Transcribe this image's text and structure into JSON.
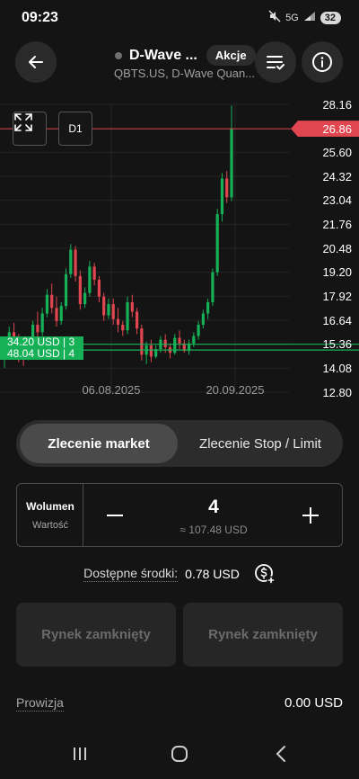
{
  "status_bar": {
    "time": "09:23",
    "network": "5G",
    "battery": "32"
  },
  "header": {
    "title": "D-Wave ...",
    "badge": "Akcje",
    "subtitle": "QBTS.US, D-Wave Quan..."
  },
  "chart": {
    "timeframe": "D1",
    "current_price": "26.86",
    "orders": [
      {
        "label": "34.20 USD | 3"
      },
      {
        "label": "48.04 USD | 4"
      }
    ],
    "colors": {
      "up": "#16b157",
      "down": "#e0464f",
      "price_line": "#e0464f",
      "order_line": "#16b157"
    }
  },
  "chart_data": {
    "type": "candlestick",
    "x_tick_labels": [
      "06.08.2025",
      "20.09.2025"
    ],
    "y_tick_labels": [
      "28.16",
      "26.86",
      "25.60",
      "24.32",
      "23.04",
      "21.76",
      "20.48",
      "19.20",
      "17.92",
      "16.64",
      "15.36",
      "14.08",
      "12.80"
    ],
    "ylim": [
      12.8,
      28.16
    ],
    "last_price": 26.86,
    "order_lines": [
      15.36,
      15.05
    ],
    "candles": [
      {
        "o": 14.7,
        "h": 15.6,
        "l": 14.1,
        "c": 15.2
      },
      {
        "o": 15.2,
        "h": 16.3,
        "l": 15.0,
        "c": 16.0
      },
      {
        "o": 16.0,
        "h": 16.5,
        "l": 14.9,
        "c": 15.1
      },
      {
        "o": 15.1,
        "h": 15.9,
        "l": 14.4,
        "c": 14.8
      },
      {
        "o": 14.8,
        "h": 15.3,
        "l": 14.2,
        "c": 14.6
      },
      {
        "o": 14.6,
        "h": 15.7,
        "l": 14.5,
        "c": 15.5
      },
      {
        "o": 15.5,
        "h": 16.6,
        "l": 15.3,
        "c": 16.4
      },
      {
        "o": 16.4,
        "h": 17.1,
        "l": 15.7,
        "c": 16.0
      },
      {
        "o": 16.0,
        "h": 17.3,
        "l": 15.8,
        "c": 17.0
      },
      {
        "o": 17.0,
        "h": 18.3,
        "l": 16.8,
        "c": 18.0
      },
      {
        "o": 18.0,
        "h": 18.6,
        "l": 17.0,
        "c": 17.3
      },
      {
        "o": 17.3,
        "h": 17.9,
        "l": 16.3,
        "c": 16.6
      },
      {
        "o": 16.6,
        "h": 17.6,
        "l": 16.4,
        "c": 17.4
      },
      {
        "o": 17.4,
        "h": 19.4,
        "l": 17.2,
        "c": 19.1
      },
      {
        "o": 19.1,
        "h": 20.7,
        "l": 18.9,
        "c": 20.4
      },
      {
        "o": 20.4,
        "h": 20.6,
        "l": 18.7,
        "c": 19.0
      },
      {
        "o": 19.0,
        "h": 19.3,
        "l": 17.2,
        "c": 17.5
      },
      {
        "o": 17.5,
        "h": 18.4,
        "l": 17.3,
        "c": 18.1
      },
      {
        "o": 18.1,
        "h": 19.8,
        "l": 17.9,
        "c": 19.5
      },
      {
        "o": 19.5,
        "h": 19.7,
        "l": 18.5,
        "c": 18.8
      },
      {
        "o": 18.8,
        "h": 19.0,
        "l": 17.6,
        "c": 17.9
      },
      {
        "o": 17.9,
        "h": 18.1,
        "l": 16.6,
        "c": 16.9
      },
      {
        "o": 16.9,
        "h": 17.8,
        "l": 16.7,
        "c": 17.5
      },
      {
        "o": 17.5,
        "h": 17.8,
        "l": 16.4,
        "c": 16.7
      },
      {
        "o": 16.7,
        "h": 17.3,
        "l": 16.0,
        "c": 16.4
      },
      {
        "o": 16.4,
        "h": 16.6,
        "l": 15.8,
        "c": 16.1
      },
      {
        "o": 16.1,
        "h": 17.9,
        "l": 15.9,
        "c": 17.6
      },
      {
        "o": 17.6,
        "h": 18.0,
        "l": 16.8,
        "c": 17.1
      },
      {
        "o": 17.1,
        "h": 17.3,
        "l": 15.9,
        "c": 16.2
      },
      {
        "o": 16.2,
        "h": 16.4,
        "l": 14.5,
        "c": 14.8
      },
      {
        "o": 14.8,
        "h": 15.5,
        "l": 14.3,
        "c": 15.3
      },
      {
        "o": 15.3,
        "h": 15.6,
        "l": 14.4,
        "c": 14.7
      },
      {
        "o": 14.7,
        "h": 15.3,
        "l": 14.6,
        "c": 15.1
      },
      {
        "o": 15.1,
        "h": 15.8,
        "l": 14.9,
        "c": 15.6
      },
      {
        "o": 15.6,
        "h": 15.9,
        "l": 14.9,
        "c": 15.2
      },
      {
        "o": 15.2,
        "h": 15.4,
        "l": 14.6,
        "c": 14.9
      },
      {
        "o": 14.9,
        "h": 15.9,
        "l": 14.8,
        "c": 15.7
      },
      {
        "o": 15.7,
        "h": 16.1,
        "l": 15.1,
        "c": 15.4
      },
      {
        "o": 15.4,
        "h": 15.6,
        "l": 14.9,
        "c": 15.0
      },
      {
        "o": 15.0,
        "h": 15.6,
        "l": 14.8,
        "c": 15.4
      },
      {
        "o": 15.4,
        "h": 16.0,
        "l": 15.2,
        "c": 15.8
      },
      {
        "o": 15.8,
        "h": 16.6,
        "l": 15.6,
        "c": 16.4
      },
      {
        "o": 16.4,
        "h": 17.2,
        "l": 16.2,
        "c": 17.0
      },
      {
        "o": 17.0,
        "h": 17.8,
        "l": 16.7,
        "c": 17.6
      },
      {
        "o": 17.6,
        "h": 19.4,
        "l": 17.4,
        "c": 19.2
      },
      {
        "o": 19.2,
        "h": 22.6,
        "l": 19.0,
        "c": 22.3
      },
      {
        "o": 22.3,
        "h": 24.5,
        "l": 21.9,
        "c": 24.2
      },
      {
        "o": 24.2,
        "h": 24.6,
        "l": 22.9,
        "c": 23.2
      },
      {
        "o": 23.2,
        "h": 28.1,
        "l": 23.0,
        "c": 26.86
      }
    ]
  },
  "order_tabs": [
    {
      "label": "Zlecenie market"
    },
    {
      "label": "Zlecenie Stop / Limit"
    }
  ],
  "volume": {
    "label": "Wolumen",
    "sub_label": "Wartość",
    "quantity": "4",
    "approx_value": "≈ 107.48 USD"
  },
  "funds": {
    "label": "Dostępne środki:",
    "value": "0.78 USD"
  },
  "buttons": {
    "left": "Rynek zamknięty",
    "right": "Rynek zamknięty"
  },
  "commission": {
    "label": "Prowizja",
    "value": "0.00 USD"
  },
  "icons": {
    "back": "arrow-left-icon",
    "list": "list-check-icon",
    "info": "info-icon",
    "fullscreen": "expand-icon",
    "dollar": "dollar-plus-icon"
  }
}
